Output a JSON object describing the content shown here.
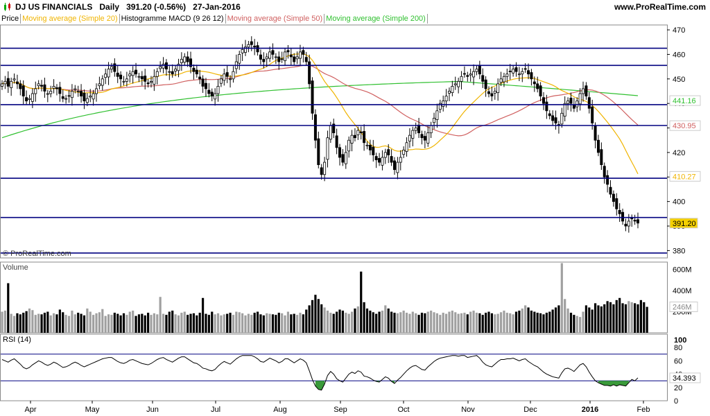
{
  "header": {
    "instrument": "DJ US FINANCIALS",
    "period": "Daily",
    "last": "391.20 (-0.56%)",
    "date": "27-Jan-2016",
    "brand": "www.ProRealTime.com",
    "watermark": "© ProRealTime.com"
  },
  "legend": [
    {
      "label": "Price",
      "color": "#000000"
    },
    {
      "label": "Moving average (Simple 20)",
      "color": "#f0b400"
    },
    {
      "label": "Histogramme MACD (9 26 12)",
      "color": "#000000"
    },
    {
      "label": "Moving average (Simple 50)",
      "color": "#d06060"
    },
    {
      "label": "Moving average (Simple 200)",
      "color": "#30c030"
    }
  ],
  "colors": {
    "sma20": "#f0b400",
    "sma50": "#d06060",
    "sma200": "#30c030",
    "hlines": "#000080",
    "last_badge": "#f5d000"
  },
  "chart_data": [
    {
      "type": "candlestick",
      "panel": "price",
      "ylim": [
        377,
        472
      ],
      "yticks": [
        380,
        390,
        400,
        410,
        420,
        430,
        440,
        450,
        460,
        470
      ],
      "ytick_labels": [
        "380",
        "390",
        "400",
        "410",
        "420",
        "430",
        "440",
        "450",
        "460",
        "470"
      ],
      "x_months": [
        "Apr",
        "May",
        "Jun",
        "Jul",
        "Aug",
        "Sep",
        "Oct",
        "Nov",
        "Dec",
        "2016",
        "Feb"
      ],
      "horizontal_lines": [
        462.5,
        455.5,
        439.5,
        431,
        409.5,
        393.5,
        379
      ],
      "right_labels": [
        {
          "text": "441.16",
          "value": 441.16,
          "color": "#30c030"
        },
        {
          "text": "430.95",
          "value": 430.95,
          "color": "#d06060"
        },
        {
          "text": "410.27",
          "value": 410.27,
          "color": "#f0b400"
        },
        {
          "text": "391.20",
          "value": 391.2,
          "color": "#000000",
          "badge": true
        }
      ],
      "close": [
        448,
        449,
        447,
        449,
        450,
        448,
        446,
        443,
        441,
        442,
        444,
        446,
        448,
        447,
        445,
        444,
        445,
        447,
        446,
        444,
        442,
        442,
        443,
        445,
        446,
        445,
        443,
        441,
        442,
        443,
        444,
        446,
        448,
        450,
        452,
        454,
        455,
        453,
        451,
        450,
        449,
        450,
        452,
        453,
        452,
        451,
        450,
        449,
        448,
        449,
        451,
        453,
        455,
        456,
        454,
        453,
        452,
        454,
        456,
        458,
        459,
        457,
        455,
        453,
        452,
        450,
        447,
        446,
        444,
        443,
        444,
        447,
        450,
        452,
        451,
        450,
        453,
        457,
        460,
        462,
        463,
        464,
        464,
        463,
        461,
        458,
        457,
        459,
        461,
        460,
        459,
        457,
        458,
        461,
        461,
        459,
        457,
        459,
        461,
        460,
        457,
        448,
        436,
        425,
        415,
        411,
        416,
        426,
        431,
        428,
        422,
        418,
        416,
        420,
        425,
        427,
        426,
        429,
        428,
        424,
        423,
        421,
        419,
        417,
        416,
        418,
        420,
        419,
        416,
        413,
        416,
        418,
        421,
        424,
        427,
        429,
        430,
        428,
        426,
        425,
        428,
        431,
        434,
        437,
        440,
        441,
        443,
        445,
        447,
        448,
        449,
        451,
        452,
        451,
        452,
        453,
        454,
        452,
        449,
        446,
        444,
        443,
        445,
        448,
        450,
        451,
        452,
        453,
        454,
        453,
        452,
        453,
        454,
        452,
        450,
        448,
        446,
        443,
        440,
        437,
        435,
        433,
        432,
        431,
        436,
        440,
        441,
        440,
        438,
        441,
        444,
        446,
        443,
        438,
        432,
        425,
        420,
        415,
        410,
        407,
        403,
        400,
        397,
        395,
        392,
        390,
        392,
        393,
        392,
        391.2
      ],
      "series": [
        {
          "name": "Moving average (Simple 20)",
          "last": 410.27
        },
        {
          "name": "Moving average (Simple 50)",
          "last": 430.95
        },
        {
          "name": "Moving average (Simple 200)",
          "last": 441.16
        }
      ]
    },
    {
      "type": "bar",
      "panel": "volume",
      "title": "Volume",
      "ytick_labels": [
        "600M",
        "400M",
        "246M",
        "200M"
      ],
      "yticks": [
        600,
        400,
        200
      ],
      "ylim": [
        0,
        670
      ],
      "last": 246,
      "last_label": "246M",
      "values": [
        200,
        210,
        470,
        180,
        160,
        185,
        175,
        190,
        205,
        230,
        215,
        170,
        180,
        175,
        190,
        200,
        165,
        185,
        175,
        220,
        195,
        170,
        160,
        210,
        175,
        190,
        180,
        165,
        230,
        200,
        170,
        185,
        195,
        225,
        160,
        175,
        170,
        190,
        180,
        165,
        185,
        170,
        200,
        210,
        160,
        175,
        180,
        165,
        190,
        170,
        185,
        175,
        340,
        180,
        170,
        200,
        210,
        175,
        165,
        190,
        200,
        170,
        180,
        185,
        165,
        190,
        330,
        180,
        170,
        200,
        175,
        185,
        165,
        175,
        180,
        190,
        170,
        200,
        195,
        185,
        165,
        180,
        170,
        190,
        200,
        175,
        165,
        185,
        180,
        175,
        170,
        190,
        185,
        165,
        200,
        175,
        180,
        170,
        190,
        175,
        220,
        260,
        310,
        360,
        320,
        270,
        240,
        210,
        190,
        180,
        200,
        220,
        210,
        190,
        180,
        200,
        230,
        250,
        580,
        290,
        230,
        210,
        195,
        180,
        200,
        210,
        260,
        230,
        200,
        190,
        185,
        195,
        210,
        190,
        180,
        200,
        185,
        170,
        190,
        185,
        200,
        210,
        195,
        185,
        170,
        190,
        180,
        200,
        210,
        195,
        180,
        185,
        190,
        175,
        200,
        210,
        190,
        185,
        170,
        190,
        200,
        185,
        175,
        180,
        195,
        210,
        190,
        185,
        175,
        200,
        210,
        230,
        260,
        240,
        210,
        200,
        190,
        185,
        175,
        190,
        200,
        220,
        240,
        260,
        660,
        320,
        230,
        190,
        170,
        160,
        150,
        200,
        260,
        240,
        220,
        280,
        260,
        250,
        270,
        300,
        290,
        270,
        310,
        330,
        280,
        270,
        300,
        290,
        280,
        270,
        310,
        290,
        246
      ]
    },
    {
      "type": "line",
      "panel": "rsi",
      "title": "RSI (14)",
      "ylim": [
        0,
        100
      ],
      "yticks": [
        0,
        20,
        40,
        60,
        80,
        100
      ],
      "ytick_labels": [
        "0",
        "20",
        "40",
        "60",
        "80",
        "100"
      ],
      "levels": [
        70,
        30
      ],
      "last": 34.393,
      "last_label": "34.393",
      "values": [
        62,
        60,
        58,
        61,
        63,
        59,
        55,
        50,
        48,
        50,
        54,
        57,
        60,
        58,
        55,
        53,
        55,
        58,
        56,
        53,
        50,
        51,
        53,
        56,
        58,
        56,
        53,
        51,
        53,
        55,
        57,
        59,
        61,
        63,
        64,
        65,
        65,
        62,
        59,
        57,
        56,
        58,
        61,
        62,
        60,
        58,
        56,
        55,
        54,
        56,
        59,
        62,
        64,
        65,
        62,
        60,
        58,
        61,
        64,
        66,
        66,
        63,
        60,
        57,
        56,
        53,
        49,
        48,
        46,
        45,
        47,
        52,
        56,
        59,
        57,
        55,
        59,
        63,
        66,
        68,
        68,
        68,
        68,
        66,
        63,
        59,
        58,
        61,
        64,
        62,
        60,
        57,
        59,
        63,
        63,
        60,
        57,
        60,
        63,
        61,
        57,
        45,
        32,
        22,
        17,
        16,
        25,
        38,
        44,
        40,
        33,
        30,
        28,
        34,
        40,
        43,
        41,
        45,
        43,
        37,
        36,
        34,
        31,
        29,
        28,
        32,
        36,
        34,
        29,
        26,
        31,
        35,
        40,
        45,
        49,
        52,
        53,
        50,
        47,
        46,
        51,
        55,
        59,
        62,
        64,
        65,
        66,
        67,
        68,
        68,
        67,
        68,
        68,
        65,
        66,
        67,
        68,
        64,
        58,
        54,
        52,
        51,
        55,
        59,
        62,
        62,
        63,
        63,
        64,
        62,
        60,
        62,
        63,
        59,
        56,
        53,
        51,
        47,
        43,
        40,
        38,
        36,
        35,
        34,
        42,
        48,
        49,
        47,
        44,
        49,
        54,
        56,
        51,
        43,
        36,
        30,
        27,
        25,
        23,
        23,
        22,
        24,
        22,
        24,
        23,
        22,
        27,
        32,
        30,
        34.393
      ]
    }
  ]
}
